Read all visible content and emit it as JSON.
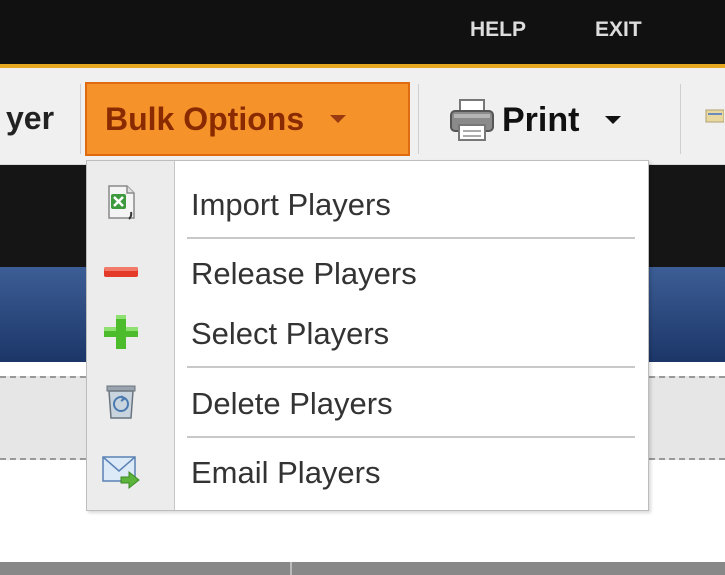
{
  "header": {
    "help_label": "HELP",
    "exit_label": "EXIT"
  },
  "toolbar": {
    "player_partial_label": "yer",
    "bulk_options_label": "Bulk Options",
    "print_label": "Print"
  },
  "bulk_menu": {
    "items": [
      {
        "label": "Import Players",
        "icon": "excel-import-icon"
      },
      {
        "label": "Release Players",
        "icon": "minus-icon"
      },
      {
        "label": "Select Players",
        "icon": "plus-icon"
      },
      {
        "label": "Delete Players",
        "icon": "recycle-bin-icon"
      },
      {
        "label": "Email Players",
        "icon": "email-forward-icon"
      }
    ]
  },
  "colors": {
    "accent": "#e5a820",
    "bulk_button_bg": "#f5922a",
    "bulk_button_text": "#8a2a00",
    "header_bg": "#111111"
  }
}
